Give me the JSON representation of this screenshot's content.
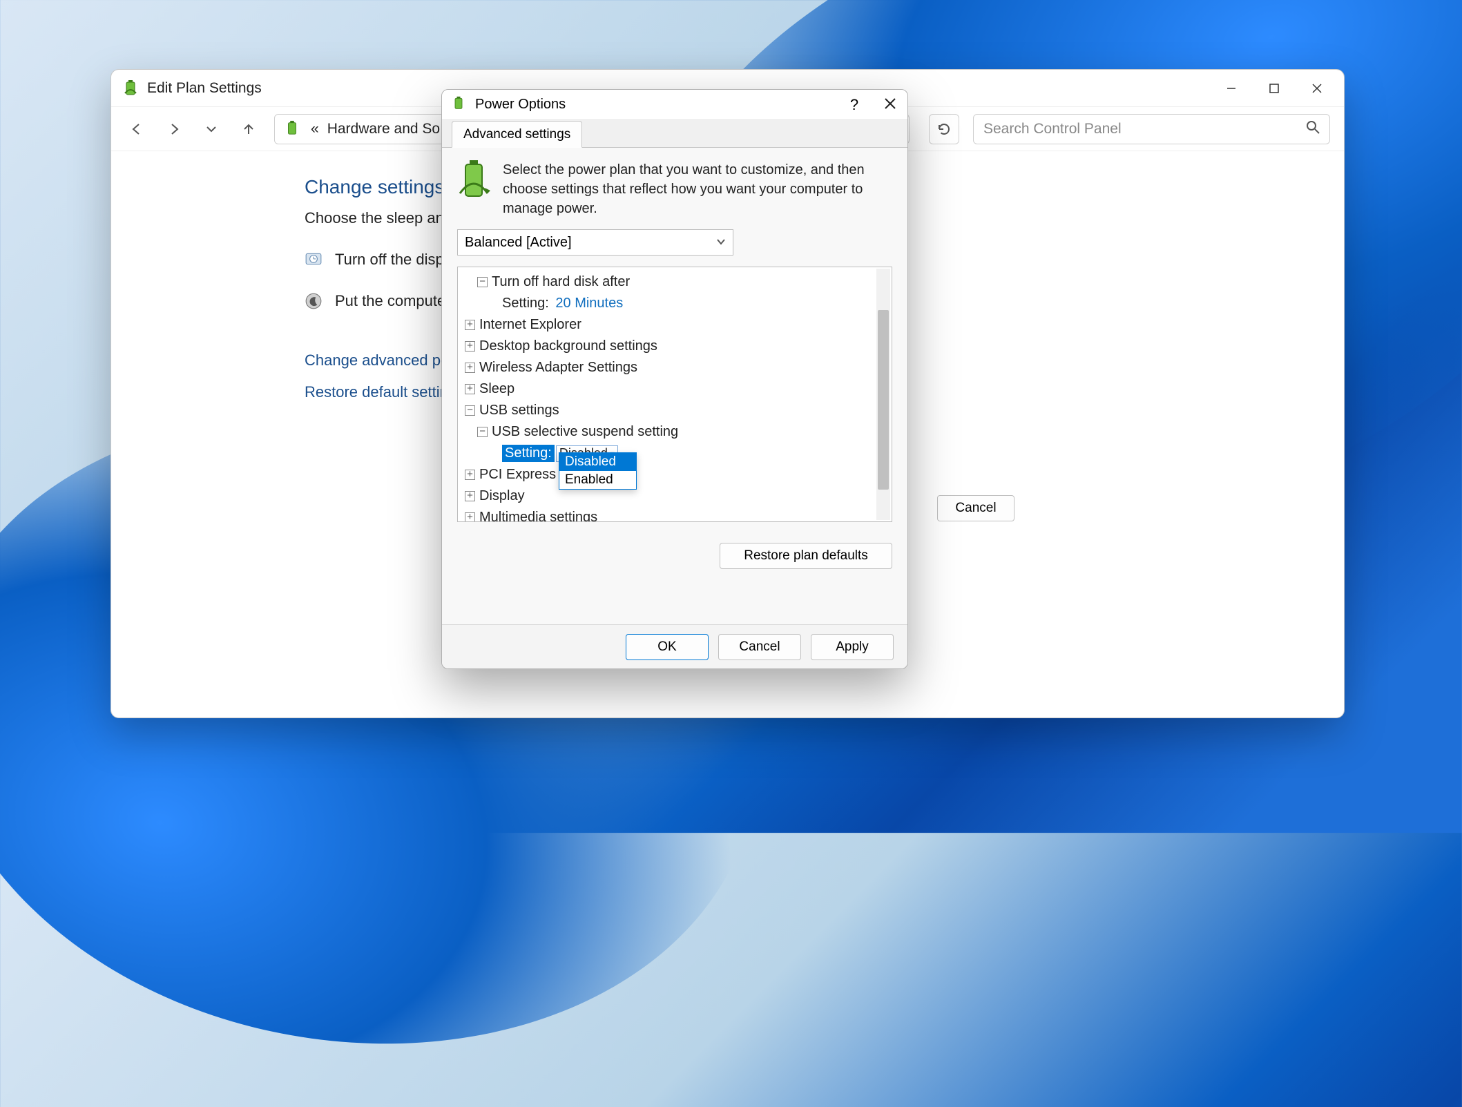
{
  "parentWindow": {
    "title": "Edit Plan Settings",
    "breadcrumb": "Hardware and So",
    "searchPlaceholder": "Search Control Panel",
    "heading": "Change settings",
    "subheading": "Choose the sleep an",
    "row1": "Turn off the disp",
    "row2": "Put the compute",
    "link1": "Change advanced po",
    "link2": "Restore default settin",
    "cancel": "Cancel"
  },
  "dialog": {
    "title": "Power Options",
    "tab": "Advanced settings",
    "intro": "Select the power plan that you want to customize, and then choose settings that reflect how you want your computer to manage power.",
    "plan": "Balanced [Active]",
    "tree": {
      "hdd": "Turn off hard disk after",
      "hddSettingLabel": "Setting:",
      "hddSettingValue": "20 Minutes",
      "ie": "Internet Explorer",
      "desk": "Desktop background settings",
      "wifi": "Wireless Adapter Settings",
      "sleep": "Sleep",
      "usb": "USB settings",
      "usbSub": "USB selective suspend setting",
      "usbSettingLabel": "Setting:",
      "usbSettingValue": "Disabled",
      "pci": "PCI Express",
      "display": "Display",
      "mm": "Multimedia settings"
    },
    "dropdown": {
      "opt1": "Disabled",
      "opt2": "Enabled"
    },
    "restore": "Restore plan defaults",
    "ok": "OK",
    "cancel": "Cancel",
    "apply": "Apply"
  }
}
